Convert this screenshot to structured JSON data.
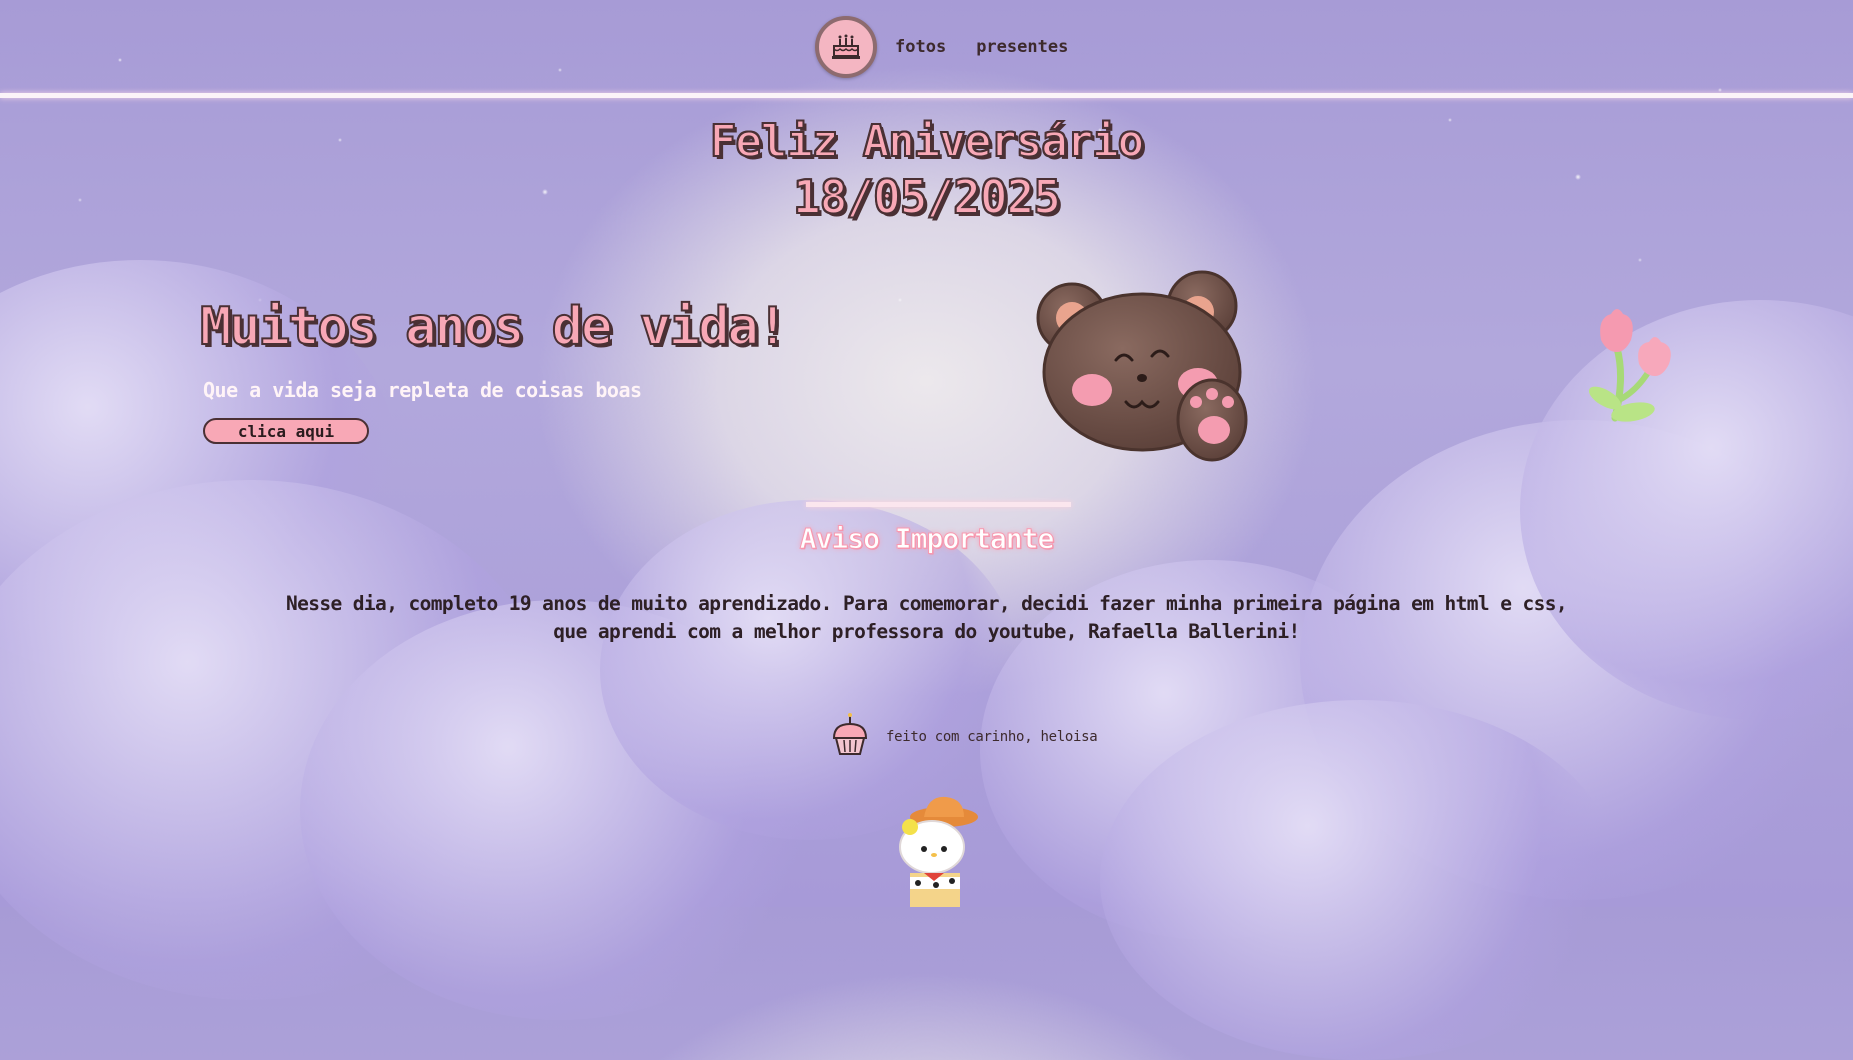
{
  "nav": {
    "logo_icon": "birthday-cake-icon",
    "links": [
      "fotos",
      "presentes"
    ]
  },
  "header": {
    "title": "Feliz Aniversário",
    "date": "18/05/2025"
  },
  "hero": {
    "title": "Muitos anos de vida!",
    "subtitle": "Que a vida seja repleta de coisas boas",
    "button_label": "clica aqui",
    "image_icon": "teddy-bear-icon",
    "decoration_icon": "tulip-flower-icon"
  },
  "notice": {
    "title": "Aviso Importante",
    "line1": "Nesse dia, completo 19 anos de muito aprendizado. Para comemorar, decidi fazer minha primeira página em html e css,",
    "line2": "que aprendi com a melhor professora do youtube, Rafaella Ballerini!"
  },
  "footer": {
    "icon": "cupcake-icon",
    "text": "feito com carinho, heloisa"
  },
  "colors": {
    "accent_pink": "#f8a8b6",
    "text_dark": "#3d2a2d",
    "bg_lavender": "#a79bd6"
  },
  "decor": {
    "bottom_icon": "hello-kitty-cowboy-icon"
  }
}
